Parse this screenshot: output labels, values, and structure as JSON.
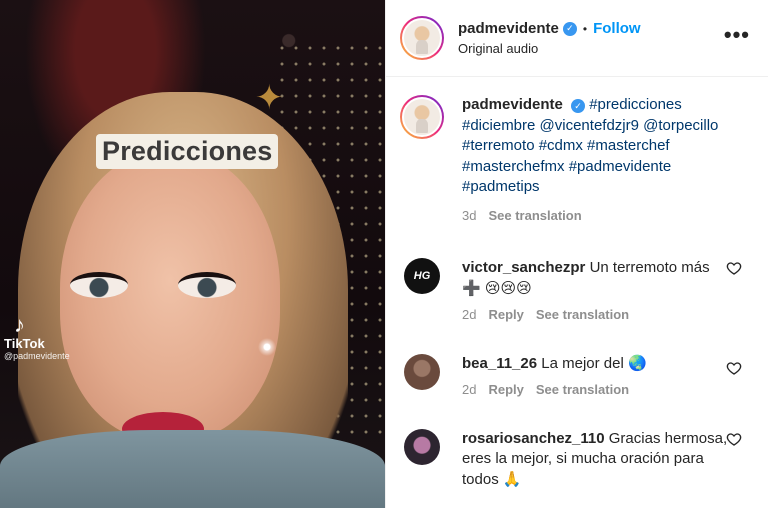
{
  "media": {
    "overlay_caption": "Predicciones",
    "tiktok_brand": "TikTok",
    "tiktok_handle": "@padmevidente"
  },
  "header": {
    "username": "padmevidente",
    "separator": "•",
    "follow_label": "Follow",
    "audio_label": "Original audio",
    "more_label": "•••"
  },
  "caption": {
    "username": "padmevidente",
    "hashtags": "#predicciones #diciembre @vicentefdzjr9 @torpecillo #terremoto #cdmx #masterchef #masterchefmx #padmevidente #padmetips",
    "time": "3d",
    "see_translation": "See translation"
  },
  "comments": [
    {
      "username": "victor_sanchezpr",
      "avatar_text": "HG",
      "text": "Un terremoto más ➕ 😢😢😢",
      "time": "2d",
      "reply": "Reply",
      "see_translation": "See translation"
    },
    {
      "username": "bea_11_26",
      "text": "La mejor del 🌏",
      "time": "2d",
      "reply": "Reply",
      "see_translation": "See translation"
    },
    {
      "username": "rosariosanchez_110",
      "text": "Gracias hermosa, eres la mejor, si mucha oración para todos 🙏",
      "time": "",
      "reply": "",
      "see_translation": ""
    }
  ],
  "colors": {
    "link_blue": "#0095f6",
    "hashtag_blue": "#00376b",
    "muted_gray": "#8e8e8e",
    "verified_blue": "#3897f0"
  },
  "icons": [
    "verified-badge-icon",
    "more-options-icon",
    "heart-icon",
    "tiktok-logo-icon"
  ]
}
